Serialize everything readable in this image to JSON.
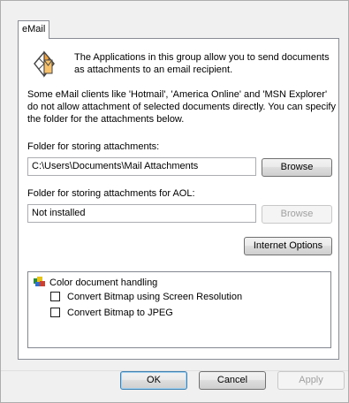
{
  "tab": {
    "label": "eMail"
  },
  "intro_text": "The Applications in this group allow you to send documents as attachments to an email recipient.",
  "note_text": "Some eMail clients like 'Hotmail', 'America Online' and 'MSN Explorer' do not allow attachment of selected documents directly. You can specify the folder for the attachments below.",
  "attachments": {
    "label": "Folder for storing attachments:",
    "value": "C:\\Users\\Documents\\Mail Attachments",
    "browse_label": "Browse"
  },
  "aol": {
    "label": "Folder for storing attachments for AOL:",
    "value": "Not installed",
    "browse_label": "Browse"
  },
  "internet_options_label": "Internet Options",
  "options_tree": {
    "root_label": "Color document handling",
    "items": [
      {
        "label": "Convert Bitmap using Screen Resolution",
        "checked": false
      },
      {
        "label": "Convert Bitmap to JPEG",
        "checked": false
      }
    ]
  },
  "footer": {
    "ok_label": "OK",
    "cancel_label": "Cancel",
    "apply_label": "Apply"
  }
}
